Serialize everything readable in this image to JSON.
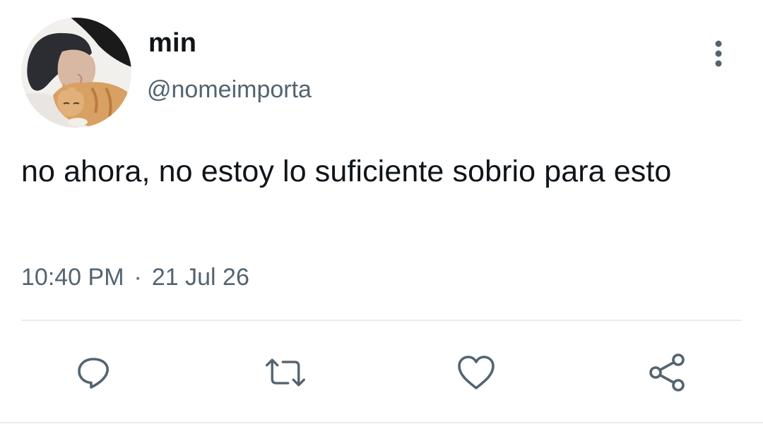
{
  "author": {
    "display_name": "min",
    "handle": "@nomeimporta"
  },
  "tweet": {
    "text": "no ahora, no estoy lo suficiente sobrio para esto",
    "time": "10:40 PM",
    "separator": "·",
    "date": "21 Jul 26"
  },
  "actions": {
    "reply_icon": "reply-icon",
    "retweet_icon": "retweet-icon",
    "like_icon": "heart-icon",
    "share_icon": "share-icon",
    "more_icon": "more-vertical-icon"
  },
  "colors": {
    "text_primary": "#0f1419",
    "text_secondary": "#536471",
    "divider": "#e6ecf0"
  }
}
